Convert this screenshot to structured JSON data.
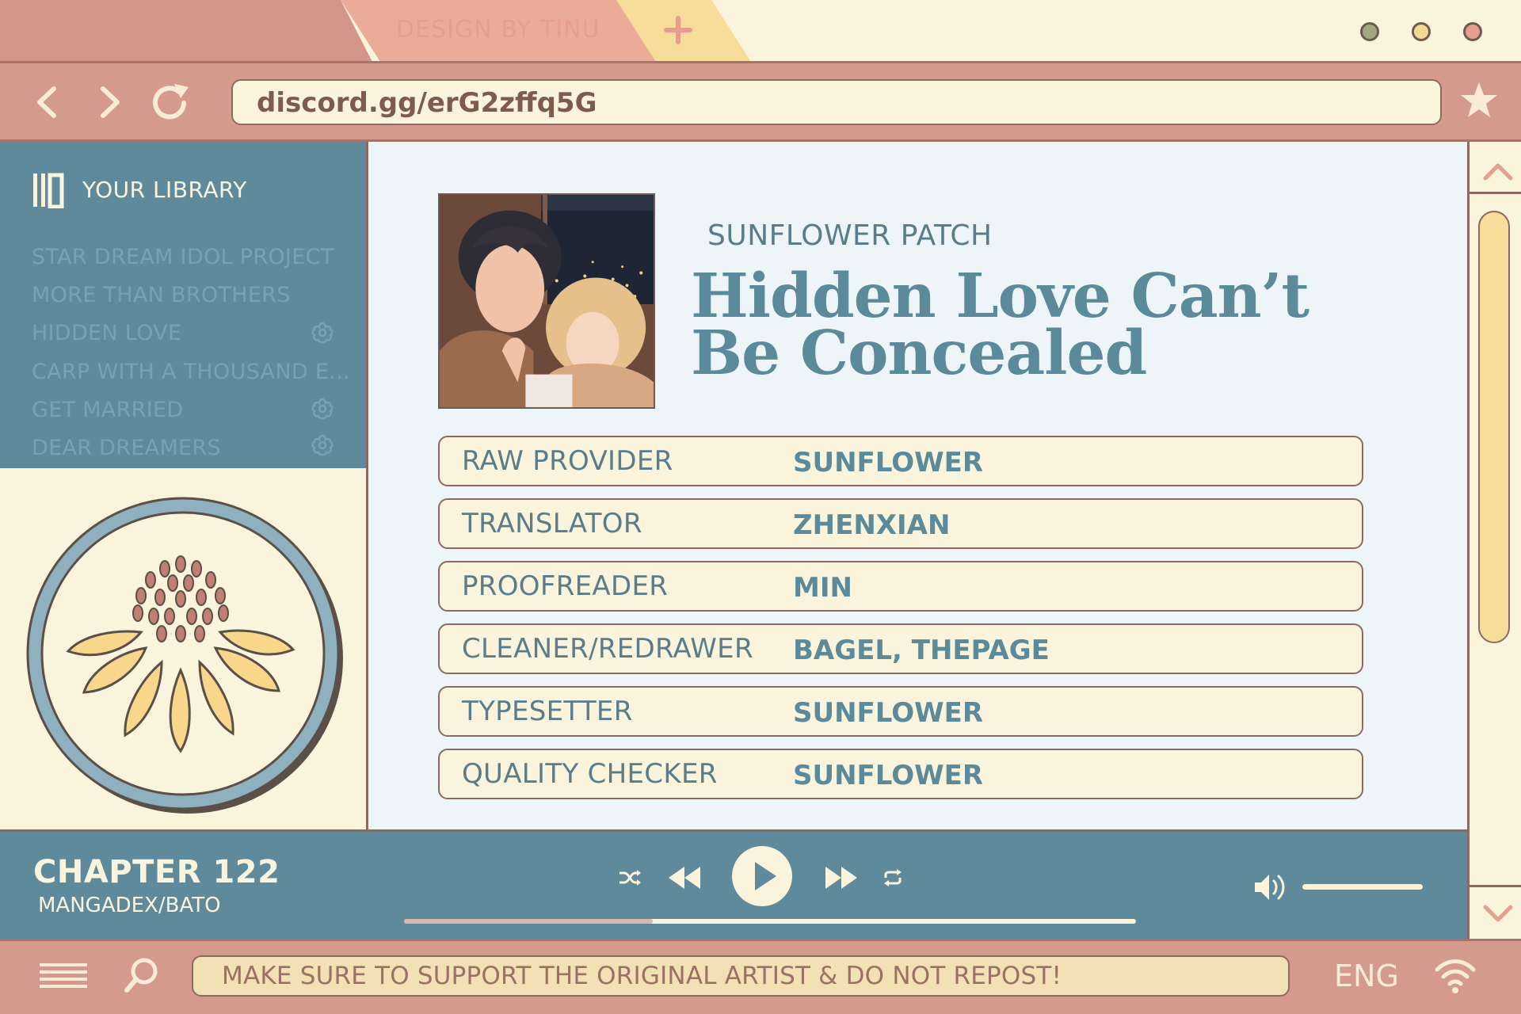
{
  "browser": {
    "tab_title": "DESIGN BY TINU",
    "url": "discord.gg/erG2zffq5G"
  },
  "sidebar": {
    "title": "YOUR LIBRARY",
    "items": [
      {
        "label": "STAR DREAM IDOL PROJECT",
        "flower": false
      },
      {
        "label": "MORE THAN BROTHERS",
        "flower": false
      },
      {
        "label": "HIDDEN LOVE",
        "flower": true
      },
      {
        "label": "CARP WITH A THOUSAND E...",
        "flower": false
      },
      {
        "label": "GET MARRIED",
        "flower": true
      },
      {
        "label": "DEAR DREAMERS",
        "flower": true
      }
    ]
  },
  "main": {
    "group": "SUNFLOWER PATCH",
    "title_line1": "Hidden Love Can’t",
    "title_line2": "Be Concealed",
    "credits": [
      {
        "role": "RAW PROVIDER",
        "name": "SUNFLOWER"
      },
      {
        "role": "TRANSLATOR",
        "name": "ZHENXIAN"
      },
      {
        "role": "PROOFREADER",
        "name": "MIN"
      },
      {
        "role": "CLEANER/REDRAWER",
        "name": "BAGEL, THEPAGE"
      },
      {
        "role": "TYPESETTER",
        "name": "SUNFLOWER"
      },
      {
        "role": "QUALITY CHECKER",
        "name": "SUNFLOWER"
      }
    ]
  },
  "player": {
    "chapter": "CHAPTER 122",
    "source": "MANGADEX/BATO",
    "progress": 0.34,
    "volume": 1.0
  },
  "bottom": {
    "message": "MAKE SURE TO SUPPORT THE ORIGINAL ARTIST & DO NOT REPOST!",
    "language": "ENG"
  },
  "colors": {
    "frame_pink": "#d59a8e",
    "cream": "#fbf4dd",
    "teal": "#5f8a9b",
    "sunflower_yellow": "#f8dd9a",
    "outline_brown": "#8a6a62"
  },
  "icons": [
    "back-icon",
    "forward-icon",
    "reload-icon",
    "star-icon",
    "library-icon",
    "flower-icon",
    "shuffle-icon",
    "rewind-icon",
    "play-icon",
    "fast-forward-icon",
    "repeat-icon",
    "volume-icon",
    "menu-icon",
    "search-icon",
    "wifi-icon",
    "scroll-up-icon",
    "scroll-down-icon"
  ]
}
